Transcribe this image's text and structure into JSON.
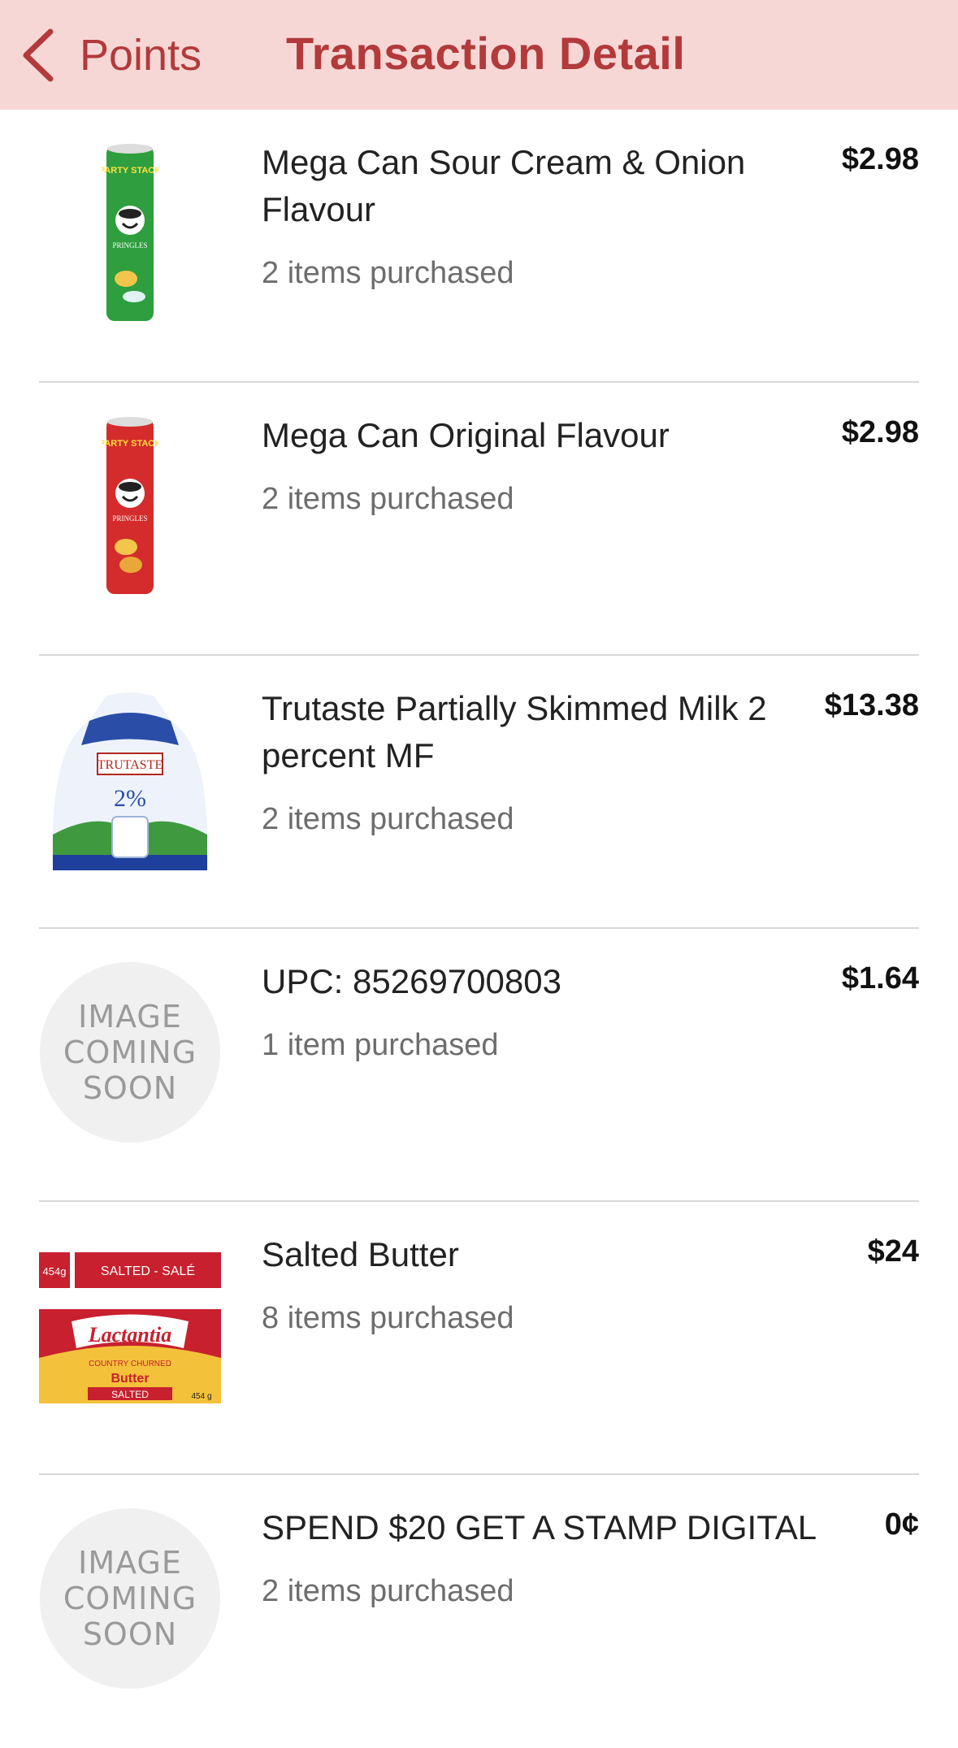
{
  "header": {
    "back_label": "Points",
    "title": "Transaction Detail"
  },
  "placeholder_text": [
    "IMAGE",
    "COMING",
    "SOON"
  ],
  "items": [
    {
      "name": "Mega Can Sour Cream & Onion Flavour",
      "quantity": "2 items purchased",
      "price": "$2.98",
      "image": "pringles-sour-cream-onion-can"
    },
    {
      "name": "Mega Can Original Flavour",
      "quantity": "2 items purchased",
      "price": "$2.98",
      "image": "pringles-original-can"
    },
    {
      "name": "Trutaste Partially Skimmed Milk 2 percent MF",
      "quantity": "2 items purchased",
      "price": "$13.38",
      "image": "milk-bag"
    },
    {
      "name": "UPC: 85269700803",
      "quantity": "1 item purchased",
      "price": "$1.64",
      "image": "image-coming-soon"
    },
    {
      "name": "Salted Butter",
      "quantity": "8 items purchased",
      "price": "$24",
      "image": "lactantia-butter"
    },
    {
      "name": "SPEND $20 GET A STAMP DIGITAL",
      "quantity": "2 items purchased",
      "price": "0¢",
      "image": "image-coming-soon"
    }
  ],
  "product_labels": {
    "party_stack": "PARTY STACK",
    "pringles": "PRINGLES",
    "trutaste": "TRUTASTE",
    "milk_pct": "2%",
    "butter_weight": "454g",
    "butter_tag": "SALTED - SALÉ",
    "lactantia": "Lactantia",
    "country_churned": "COUNTRY CHURNED",
    "butter": "Butter",
    "salted": "SALTED",
    "butter_weight_small": "454 g"
  },
  "colors": {
    "header_bg": "#f7d7d6",
    "accent": "#b23a3a"
  }
}
